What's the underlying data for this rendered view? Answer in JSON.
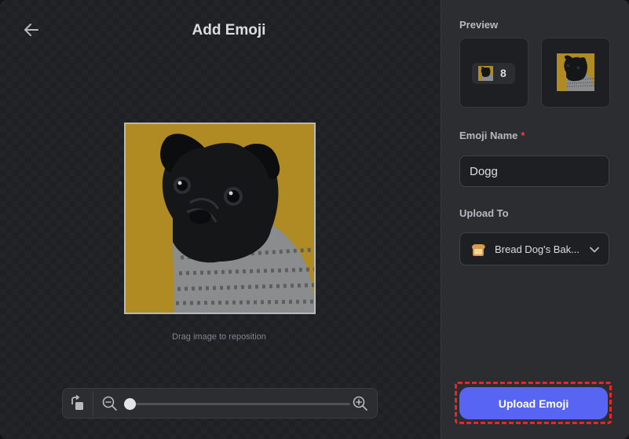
{
  "editor": {
    "title": "Add Emoji",
    "hint": "Drag image to reposition",
    "zoom_level": 0
  },
  "preview": {
    "label": "Preview",
    "reaction_count": "8"
  },
  "emoji_name": {
    "label": "Emoji Name",
    "required_mark": "*",
    "value": "Dogg"
  },
  "upload_to": {
    "label": "Upload To",
    "selected": "Bread Dog's Bak..."
  },
  "actions": {
    "upload_label": "Upload Emoji"
  },
  "colors": {
    "accent": "#5865f2",
    "emoji_background": "#b08a22",
    "highlight": "#e8272b"
  },
  "icons": [
    "back-arrow-icon",
    "rotate-icon",
    "zoom-out-icon",
    "zoom-in-icon",
    "bread-icon",
    "chevron-down-icon"
  ]
}
